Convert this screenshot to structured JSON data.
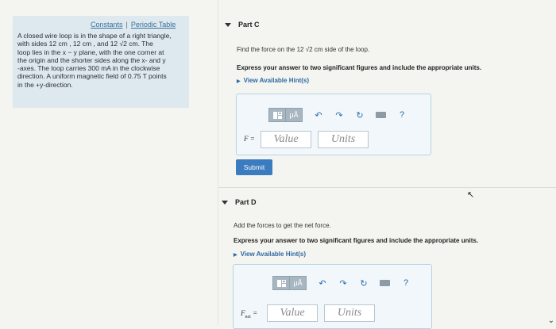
{
  "links": {
    "constants": "Constants",
    "separator": "|",
    "periodic_table": "Periodic Table"
  },
  "problem": {
    "lines": [
      "A closed wire loop is in the shape of a right triangle,",
      "with sides 12 cm , 12 cm , and 12 √2 cm. The",
      "loop lies in the x − y plane, with the one corner at",
      "the origin and the shorter sides along the x- and y",
      "-axes. The loop carries 300 mA in the clockwise",
      "direction. A uniform magnetic field of 0.75 T points",
      "in the +y-direction."
    ]
  },
  "part_c": {
    "title": "Part C",
    "question": "Find the force on the 12 √2 cm side of the loop.",
    "instruction": "Express your answer to two significant figures and include the appropriate units.",
    "hint": "View Available Hint(s)",
    "label": "F =",
    "value_placeholder": "Value",
    "units_placeholder": "Units",
    "submit": "Submit"
  },
  "part_d": {
    "title": "Part D",
    "question": "Add the forces to get the net force.",
    "instruction": "Express your answer to two significant figures and include the appropriate units.",
    "hint": "View Available Hint(s)",
    "label_main": "F",
    "label_sub": "net",
    "label_eq": " =",
    "value_placeholder": "Value",
    "units_placeholder": "Units"
  },
  "toolbar": {
    "mu_a": "μÅ",
    "help": "?"
  }
}
